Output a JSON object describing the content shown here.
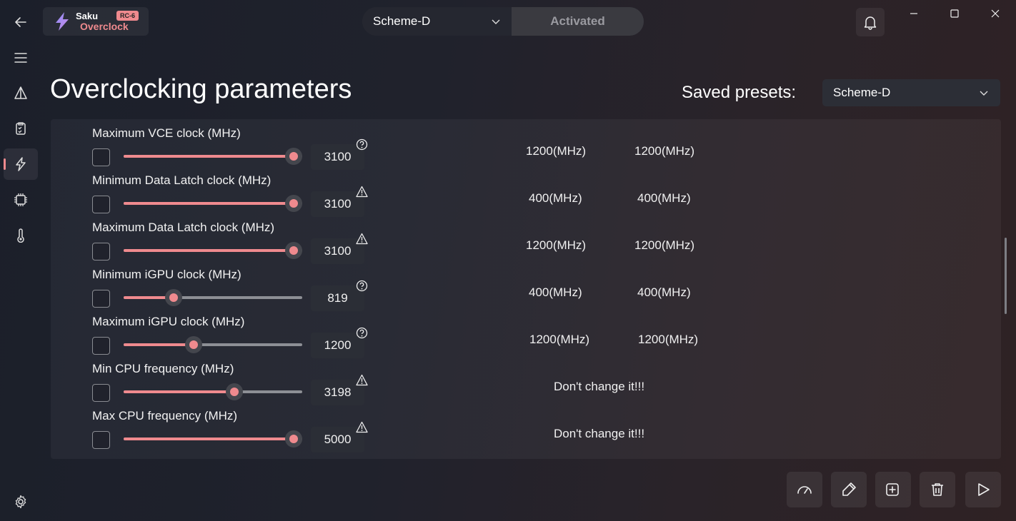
{
  "app": {
    "logo_line1": "Saku",
    "logo_line2": "Overclock",
    "badge": "RC-6"
  },
  "colors": {
    "accent": "#ef8a8e",
    "track": "#8d8f95",
    "panel": "#262833"
  },
  "nav": {
    "items": [
      {
        "name": "back-arrow-icon"
      },
      {
        "name": "hamburger-menu-icon"
      },
      {
        "name": "warning-triangle-icon"
      },
      {
        "name": "clipboard-checklist-icon"
      },
      {
        "name": "lightning-bolt-icon",
        "active": true
      },
      {
        "name": "cpu-chip-icon"
      },
      {
        "name": "thermometer-icon"
      },
      {
        "name": "settings-gear-icon"
      }
    ]
  },
  "scheme_switch": {
    "selected": "Scheme-D",
    "status": "Activated"
  },
  "header": {
    "title": "Overclocking parameters",
    "presets_label": "Saved presets:",
    "presets_selected": "Scheme-D"
  },
  "params": [
    {
      "label": "Maximum VCE clock (MHz)",
      "value": "3100",
      "fill": 0.95,
      "hint": "help-circle-icon",
      "info1": "1200(MHz)",
      "info2": "1200(MHz)"
    },
    {
      "label": "Minimum Data Latch clock (MHz)",
      "value": "3100",
      "fill": 0.95,
      "hint": "warning-triangle-icon",
      "info1": "400(MHz)",
      "info2": "400(MHz)"
    },
    {
      "label": "Maximum Data Latch clock (MHz)",
      "value": "3100",
      "fill": 0.95,
      "hint": "warning-triangle-icon",
      "info1": "1200(MHz)",
      "info2": "1200(MHz)"
    },
    {
      "label": "Minimum iGPU clock (MHz)",
      "value": "819",
      "fill": 0.28,
      "hint": "help-circle-icon",
      "info1": "400(MHz)",
      "info2": "400(MHz)"
    },
    {
      "label": "Maximum iGPU clock (MHz)",
      "value": "1200",
      "fill": 0.39,
      "hint": "help-circle-icon",
      "info1": "1200(MHz)",
      "info2": "1200(MHz)"
    },
    {
      "label": "Min CPU frequency (MHz)",
      "value": "3198",
      "fill": 0.62,
      "hint": "warning-triangle-icon",
      "note": "Don't change it!!!"
    },
    {
      "label": "Max CPU frequency (MHz)",
      "value": "5000",
      "fill": 0.95,
      "hint": "warning-triangle-icon",
      "note": "Don't change it!!!"
    }
  ],
  "actions": [
    {
      "name": "speedometer-button",
      "icon": "speedometer-icon"
    },
    {
      "name": "edit-preset-button",
      "icon": "pen-edit-icon"
    },
    {
      "name": "add-preset-button",
      "icon": "add-square-icon"
    },
    {
      "name": "delete-preset-button",
      "icon": "trash-icon"
    },
    {
      "name": "apply-button",
      "icon": "play-icon"
    }
  ]
}
